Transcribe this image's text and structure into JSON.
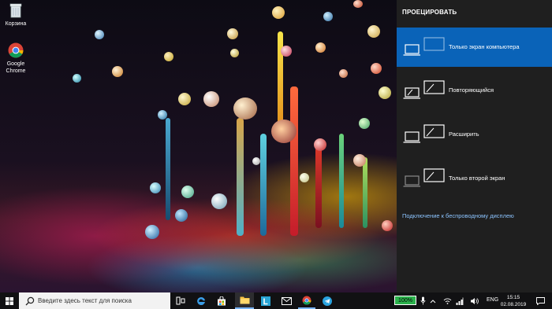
{
  "desktop": {
    "icons": [
      {
        "label": "Корзина",
        "icon": "recycle-bin-icon"
      },
      {
        "label": "Google Chrome",
        "icon": "chrome-icon"
      }
    ]
  },
  "project_panel": {
    "title": "ПРОЕЦИРОВАТЬ",
    "options": [
      {
        "label": "Только экран компьютера",
        "icon": "pc-screen-only-icon",
        "selected": true
      },
      {
        "label": "Повторяющийся",
        "icon": "duplicate-icon",
        "selected": false
      },
      {
        "label": "Расширить",
        "icon": "extend-icon",
        "selected": false
      },
      {
        "label": "Только второй экран",
        "icon": "second-screen-only-icon",
        "selected": false
      }
    ],
    "wireless_link": "Подключение к беспроводному дисплею",
    "selected_color": "#0a63b8"
  },
  "taskbar": {
    "search_placeholder": "Введите здесь текст для поиска",
    "pinned": [
      "task-view-icon",
      "edge-icon",
      "store-icon",
      "explorer-icon",
      "l-app-icon",
      "mail-icon",
      "chrome-icon",
      "telegram-icon"
    ],
    "battery": "100%",
    "language": "ENG",
    "time": "15:15",
    "date": "02.08.2019"
  }
}
